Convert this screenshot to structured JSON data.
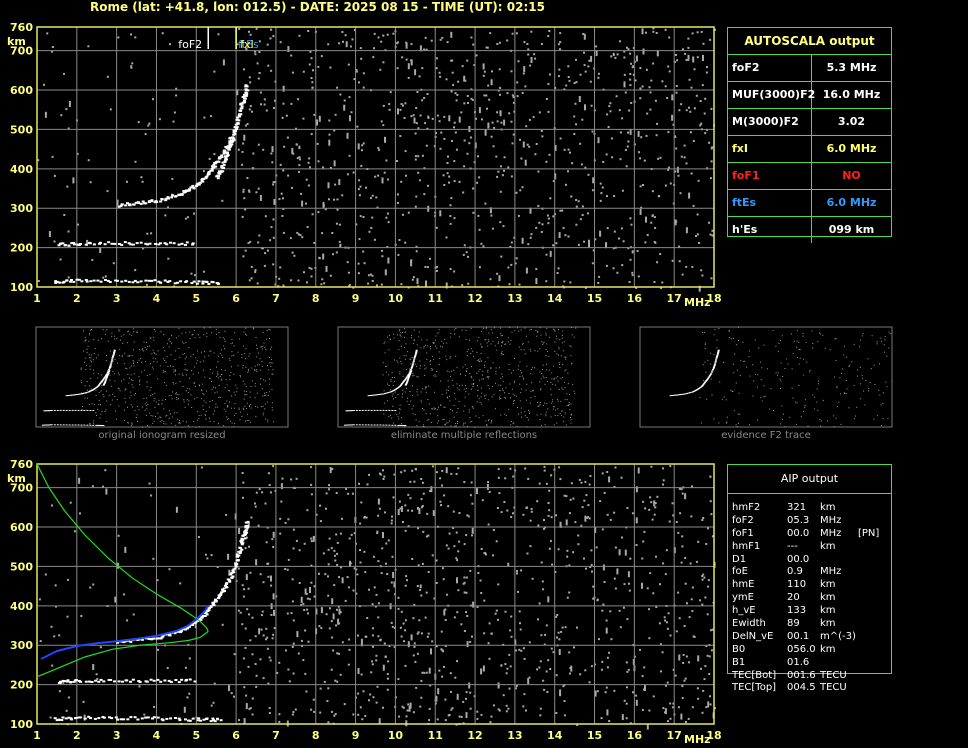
{
  "header": {
    "title": "Rome (lat: +41.8, lon: 012.5) - DATE: 2025 08 15 - TIME (UT): 02:15"
  },
  "colors": {
    "grid": "#8a8a8a",
    "frame": "#e8e860",
    "panel_border": "#4cd94c",
    "axis_text": "#ffff80",
    "profile_green": "#22dd22",
    "profile_blue": "#2244ff",
    "trace": "#ffffff",
    "noise": "#aaaaaa"
  },
  "chart_data": [
    {
      "type": "scatter",
      "name_key": "main-ionogram",
      "xlabel": "MHz",
      "ylabel": "km",
      "xlim": [
        1,
        18
      ],
      "ylim": [
        100,
        760
      ],
      "x_ticks": [
        "1",
        "2",
        "3",
        "4",
        "5",
        "6",
        "7",
        "8",
        "9",
        "10",
        "11",
        "12",
        "13",
        "14",
        "15",
        "16",
        "17",
        "18"
      ],
      "y_ticks": [
        "100",
        "200",
        "300",
        "400",
        "500",
        "600",
        "700",
        "760"
      ],
      "markers": [
        {
          "label": "foF2",
          "x": 5.3,
          "color": "#ffffff"
        },
        {
          "label": "ftEs",
          "x": 6.0,
          "color": "#3399ff"
        },
        {
          "label": "fxI",
          "x": 6.0,
          "color": "#ffff66"
        }
      ],
      "traces": [
        {
          "name": "F2 trace",
          "points": [
            [
              3.0,
              310
            ],
            [
              3.5,
              315
            ],
            [
              4.0,
              322
            ],
            [
              4.5,
              335
            ],
            [
              4.8,
              350
            ],
            [
              5.1,
              370
            ],
            [
              5.3,
              395
            ],
            [
              5.5,
              420
            ],
            [
              5.7,
              450
            ],
            [
              5.9,
              490
            ],
            [
              6.0,
              520
            ],
            [
              6.1,
              560
            ],
            [
              6.2,
              590
            ],
            [
              6.25,
              615
            ]
          ]
        },
        {
          "name": "F2 second trace",
          "points": [
            [
              5.5,
              380
            ],
            [
              5.6,
              400
            ],
            [
              5.7,
              430
            ],
            [
              5.8,
              455
            ],
            [
              5.9,
              480
            ]
          ]
        },
        {
          "name": "Es trace",
          "points": [
            [
              1.5,
              210
            ],
            [
              2.0,
              212
            ],
            [
              3.0,
              213
            ],
            [
              4.0,
              213
            ],
            [
              5.0,
              212
            ]
          ]
        },
        {
          "name": "ground trace",
          "points": [
            [
              1.4,
              115
            ],
            [
              2.0,
              118
            ],
            [
              3.0,
              117
            ],
            [
              4.0,
              116
            ],
            [
              5.0,
              114
            ],
            [
              5.6,
              113
            ]
          ]
        }
      ]
    },
    {
      "type": "scatter",
      "name_key": "aip-ionogram",
      "xlabel": "MHz",
      "ylabel": "km",
      "xlim": [
        1,
        18
      ],
      "ylim": [
        100,
        760
      ],
      "x_ticks": [
        "1",
        "2",
        "3",
        "4",
        "5",
        "6",
        "7",
        "8",
        "9",
        "10",
        "11",
        "12",
        "13",
        "14",
        "15",
        "16",
        "17",
        "18"
      ],
      "y_ticks": [
        "100",
        "200",
        "300",
        "400",
        "500",
        "600",
        "700",
        "760"
      ],
      "traces": [
        {
          "name": "F2 trace",
          "points": [
            [
              3.0,
              310
            ],
            [
              3.5,
              315
            ],
            [
              4.0,
              322
            ],
            [
              4.5,
              335
            ],
            [
              4.8,
              350
            ],
            [
              5.1,
              370
            ],
            [
              5.3,
              395
            ],
            [
              5.5,
              420
            ],
            [
              5.7,
              450
            ],
            [
              5.9,
              490
            ],
            [
              6.0,
              520
            ],
            [
              6.1,
              560
            ],
            [
              6.2,
              590
            ],
            [
              6.25,
              615
            ]
          ]
        },
        {
          "name": "Es trace",
          "points": [
            [
              1.5,
              210
            ],
            [
              2.0,
              212
            ],
            [
              3.0,
              213
            ],
            [
              4.0,
              213
            ],
            [
              5.0,
              212
            ]
          ]
        },
        {
          "name": "ground trace",
          "points": [
            [
              1.4,
              115
            ],
            [
              2.0,
              118
            ],
            [
              3.0,
              117
            ],
            [
              4.0,
              116
            ],
            [
              5.0,
              114
            ],
            [
              5.6,
              113
            ]
          ]
        }
      ],
      "profile_upper": [
        [
          1.0,
          760
        ],
        [
          1.3,
          700
        ],
        [
          1.7,
          640
        ],
        [
          2.2,
          580
        ],
        [
          2.8,
          520
        ],
        [
          3.4,
          470
        ],
        [
          4.0,
          430
        ],
        [
          4.6,
          395
        ],
        [
          4.9,
          375
        ],
        [
          5.1,
          360
        ],
        [
          5.25,
          345
        ],
        [
          5.3,
          335
        ]
      ],
      "profile_lower": [
        [
          5.3,
          335
        ],
        [
          5.1,
          320
        ],
        [
          4.8,
          312
        ],
        [
          4.3,
          306
        ],
        [
          3.6,
          300
        ],
        [
          2.9,
          290
        ],
        [
          2.2,
          270
        ],
        [
          1.6,
          245
        ],
        [
          1.2,
          228
        ],
        [
          1.0,
          220
        ]
      ],
      "profile_fit": [
        [
          1.1,
          265
        ],
        [
          1.5,
          285
        ],
        [
          2.0,
          298
        ],
        [
          2.5,
          305
        ],
        [
          3.0,
          310
        ],
        [
          3.5,
          316
        ],
        [
          4.0,
          324
        ],
        [
          4.5,
          336
        ],
        [
          4.8,
          350
        ],
        [
          5.0,
          365
        ],
        [
          5.2,
          385
        ],
        [
          5.3,
          400
        ]
      ]
    }
  ],
  "thumbnails": [
    {
      "caption": "original ionogram resized"
    },
    {
      "caption": "eliminate multiple reflections"
    },
    {
      "caption": "evidence F2 trace"
    }
  ],
  "autoscala": {
    "title": "AUTOSCALA output",
    "rows": [
      {
        "name": "foF2",
        "value": "5.3 MHz",
        "name_color": "#ffffff",
        "value_color": "#ffffff"
      },
      {
        "name": "MUF(3000)F2",
        "value": "16.0 MHz",
        "name_color": "#ffffff",
        "value_color": "#ffffff"
      },
      {
        "name": "M(3000)F2",
        "value": "3.02",
        "name_color": "#ffffff",
        "value_color": "#ffffff"
      },
      {
        "name": "fxI",
        "value": "6.0 MHz",
        "name_color": "#ffff66",
        "value_color": "#ffff66"
      },
      {
        "name": "foF1",
        "value": "NO",
        "name_color": "#ff2020",
        "value_color": "#ff2020"
      },
      {
        "name": "ftEs",
        "value": "6.0 MHz",
        "name_color": "#3399ff",
        "value_color": "#3399ff"
      },
      {
        "name": "h'Es",
        "value": "099    km",
        "name_color": "#ffffff",
        "value_color": "#ffffff"
      }
    ]
  },
  "aip": {
    "title": "AIP output",
    "rows": [
      {
        "c1": "hmF2",
        "c2": "321",
        "c3": "km",
        "c4": ""
      },
      {
        "c1": "foF2",
        "c2": "05.3",
        "c3": "MHz",
        "c4": ""
      },
      {
        "c1": "foF1",
        "c2": "00.0",
        "c3": "MHz",
        "c4": "[PN]"
      },
      {
        "c1": "hmF1",
        "c2": "---",
        "c3": "km",
        "c4": ""
      },
      {
        "c1": "D1",
        "c2": "00.0",
        "c3": "",
        "c4": ""
      },
      {
        "c1": "foE",
        "c2": "0.9",
        "c3": "MHz",
        "c4": ""
      },
      {
        "c1": "hmE",
        "c2": "110",
        "c3": "km",
        "c4": ""
      },
      {
        "c1": "ymE",
        "c2": "20",
        "c3": "km",
        "c4": ""
      },
      {
        "c1": "h_vE",
        "c2": "133",
        "c3": "km",
        "c4": ""
      },
      {
        "c1": "Ewidth",
        "c2": "89",
        "c3": "km",
        "c4": ""
      },
      {
        "c1": "DelN_vE",
        "c2": "00.1",
        "c3": "m^(-3)",
        "c4": ""
      },
      {
        "c1": "B0",
        "c2": "056.0",
        "c3": "km",
        "c4": ""
      },
      {
        "c1": "B1",
        "c2": "01.6",
        "c3": "",
        "c4": ""
      },
      {
        "c1": "TEC[Bot]",
        "c2": "001.6",
        "c3": "TECU",
        "c4": ""
      },
      {
        "c1": "TEC[Top]",
        "c2": "004.5",
        "c3": "TECU",
        "c4": ""
      }
    ]
  }
}
